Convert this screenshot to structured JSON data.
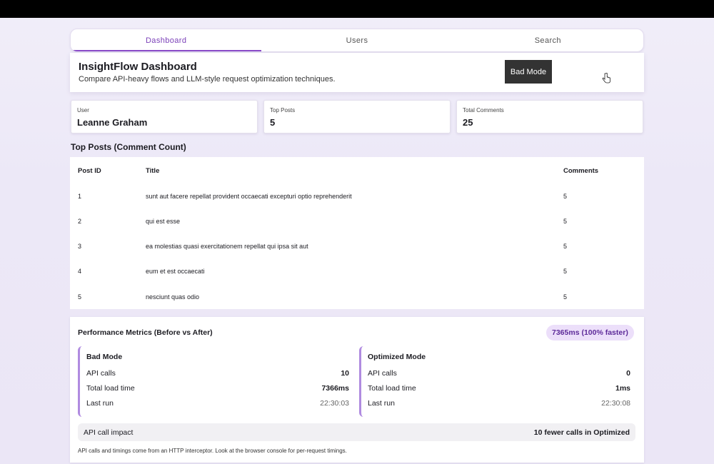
{
  "tabs": [
    {
      "label": "Dashboard",
      "active": true
    },
    {
      "label": "Users",
      "active": false
    },
    {
      "label": "Search",
      "active": false
    }
  ],
  "header": {
    "title": "InsightFlow Dashboard",
    "subtitle": "Compare API-heavy flows and LLM-style request optimization techniques.",
    "mode_button": "Bad Mode"
  },
  "stats": [
    {
      "label": "User",
      "value": "Leanne Graham"
    },
    {
      "label": "Top Posts",
      "value": "5"
    },
    {
      "label": "Total Comments",
      "value": "25"
    }
  ],
  "posts_section": {
    "title": "Top Posts (Comment Count)",
    "columns": [
      "Post ID",
      "Title",
      "Comments"
    ],
    "rows": [
      {
        "id": "1",
        "title": "sunt aut facere repellat provident occaecati excepturi optio reprehenderit",
        "comments": "5"
      },
      {
        "id": "2",
        "title": "qui est esse",
        "comments": "5"
      },
      {
        "id": "3",
        "title": "ea molestias quasi exercitationem repellat qui ipsa sit aut",
        "comments": "5"
      },
      {
        "id": "4",
        "title": "eum et est occaecati",
        "comments": "5"
      },
      {
        "id": "5",
        "title": "nesciunt quas odio",
        "comments": "5"
      }
    ]
  },
  "metrics": {
    "title": "Performance Metrics (Before vs After)",
    "badge": "7365ms (100% faster)",
    "labels": {
      "api_calls": "API calls",
      "load_time": "Total load time",
      "last_run": "Last run"
    },
    "bad": {
      "title": "Bad Mode",
      "api_calls": "10",
      "load_time": "7366ms",
      "last_run": "22:30:03"
    },
    "optimized": {
      "title": "Optimized Mode",
      "api_calls": "0",
      "load_time": "1ms",
      "last_run": "22:30:08"
    },
    "impact_label": "API call impact",
    "impact_value": "10 fewer calls in Optimized",
    "footnote": "API calls and timings come from an HTTP interceptor. Look at the browser console for per-request timings."
  },
  "colors": {
    "accent": "#8a4cc9",
    "badge_bg": "#ecdffa",
    "badge_text": "#5d2a99",
    "button_bg": "#333333"
  },
  "icons": {
    "cursor": "pointer-hand-icon"
  }
}
